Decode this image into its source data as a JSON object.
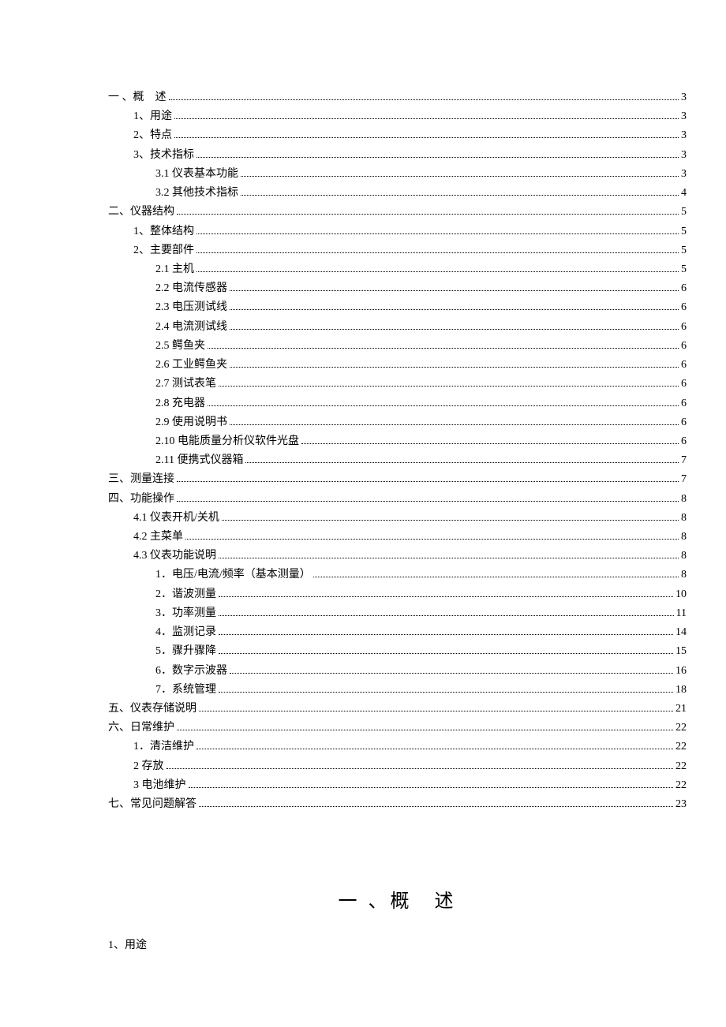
{
  "toc": [
    {
      "level": 0,
      "title": "一 、概　述",
      "page": "3"
    },
    {
      "level": 1,
      "title": "1、用途",
      "page": "3"
    },
    {
      "level": 1,
      "title": "2、特点",
      "page": "3"
    },
    {
      "level": 1,
      "title": "3、技术指标",
      "page": "3"
    },
    {
      "level": 2,
      "title": "3.1 仪表基本功能",
      "page": "3"
    },
    {
      "level": 2,
      "title": "3.2 其他技术指标",
      "page": "4"
    },
    {
      "level": 0,
      "title": "二、仪器结构",
      "page": "5"
    },
    {
      "level": 1,
      "title": "1、整体结构",
      "page": "5"
    },
    {
      "level": 1,
      "title": "2、主要部件",
      "page": "5"
    },
    {
      "level": 2,
      "title": "2.1 主机",
      "page": "5"
    },
    {
      "level": 2,
      "title": "2.2 电流传感器",
      "page": "6"
    },
    {
      "level": 2,
      "title": "2.3 电压测试线",
      "page": "6"
    },
    {
      "level": 2,
      "title": "2.4 电流测试线",
      "page": "6"
    },
    {
      "level": 2,
      "title": "2.5 鳄鱼夹",
      "page": "6"
    },
    {
      "level": 2,
      "title": "2.6 工业鳄鱼夹",
      "page": "6"
    },
    {
      "level": 2,
      "title": "2.7 测试表笔",
      "page": "6"
    },
    {
      "level": 2,
      "title": "2.8 充电器",
      "page": "6"
    },
    {
      "level": 2,
      "title": "2.9 使用说明书",
      "page": "6"
    },
    {
      "level": 2,
      "title": "2.10 电能质量分析仪软件光盘",
      "page": "6"
    },
    {
      "level": 2,
      "title": "2.11 便携式仪器箱",
      "page": "7"
    },
    {
      "level": 0,
      "title": "三、测量连接",
      "page": "7"
    },
    {
      "level": 0,
      "title": "四、功能操作",
      "page": "8"
    },
    {
      "level": 1,
      "title": "4.1 仪表开机/关机",
      "page": "8"
    },
    {
      "level": 1,
      "title": "4.2 主菜单",
      "page": "8"
    },
    {
      "level": 1,
      "title": "4.3 仪表功能说明",
      "page": "8"
    },
    {
      "level": 2,
      "title": "1．电压/电流/频率（基本测量）",
      "page": "8"
    },
    {
      "level": 2,
      "title": "2．谐波测量",
      "page": "10"
    },
    {
      "level": 2,
      "title": "3．功率测量",
      "page": "11"
    },
    {
      "level": 2,
      "title": "4．监测记录",
      "page": "14"
    },
    {
      "level": 2,
      "title": "5．骤升骤降",
      "page": "15"
    },
    {
      "level": 2,
      "title": "6．数字示波器",
      "page": "16"
    },
    {
      "level": 2,
      "title": "7．系统管理",
      "page": "18"
    },
    {
      "level": 0,
      "title": "五、仪表存储说明",
      "page": "21"
    },
    {
      "level": 0,
      "title": "六、日常维护",
      "page": "22"
    },
    {
      "level": 1,
      "title": "1．清洁维护",
      "page": "22"
    },
    {
      "level": 1,
      "title": "2 存放",
      "page": "22"
    },
    {
      "level": 1,
      "title": "3 电池维护",
      "page": "22"
    },
    {
      "level": 0,
      "title": "七、常见问题解答",
      "page": "23"
    }
  ],
  "heading": "一 、概　述",
  "subheading": "1、用途"
}
